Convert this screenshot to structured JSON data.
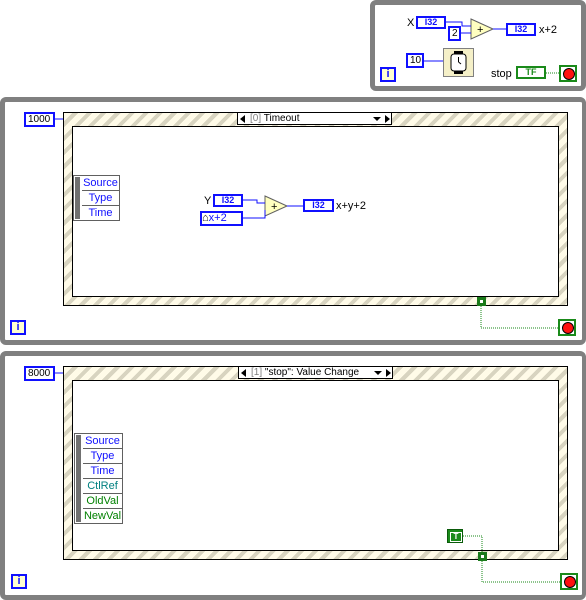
{
  "top_loop": {
    "x_control": {
      "label": "X",
      "type": "I32"
    },
    "constant_2": "2",
    "add_op": "+",
    "x_plus_2_indicator": {
      "type": "I32",
      "label": "x+2"
    },
    "wait_ms_constant": "10",
    "wait_icon": "wait-ms-icon",
    "stop_control": {
      "label": "stop",
      "type": "TF"
    },
    "iteration_terminal": "i"
  },
  "loop_1": {
    "timeout_constant": "1000",
    "event_selector": {
      "index": "[0]",
      "label": "Timeout"
    },
    "event_data_node": [
      "Source",
      "Type",
      "Time"
    ],
    "y_control": {
      "label": "Y",
      "type": "I32"
    },
    "local_variable": {
      "label": "x+2"
    },
    "add_op": "+",
    "result_indicator": {
      "type": "I32",
      "label": "x+y+2"
    },
    "iteration_terminal": "i"
  },
  "loop_2": {
    "timeout_constant": "8000",
    "event_selector": {
      "index": "[1]",
      "label": "\"stop\": Value Change"
    },
    "event_data_node": [
      "Source",
      "Type",
      "Time",
      "CtlRef",
      "OldVal",
      "NewVal"
    ],
    "true_constant": "T",
    "iteration_terminal": "i"
  },
  "colors": {
    "numeric_blue": "#1010ff",
    "boolean_green": "#1a8a1a",
    "loop_gray": "#808080",
    "stop_red": "#ff1010",
    "event_fg_teal": "#008080",
    "event_fg_green": "#008000"
  }
}
